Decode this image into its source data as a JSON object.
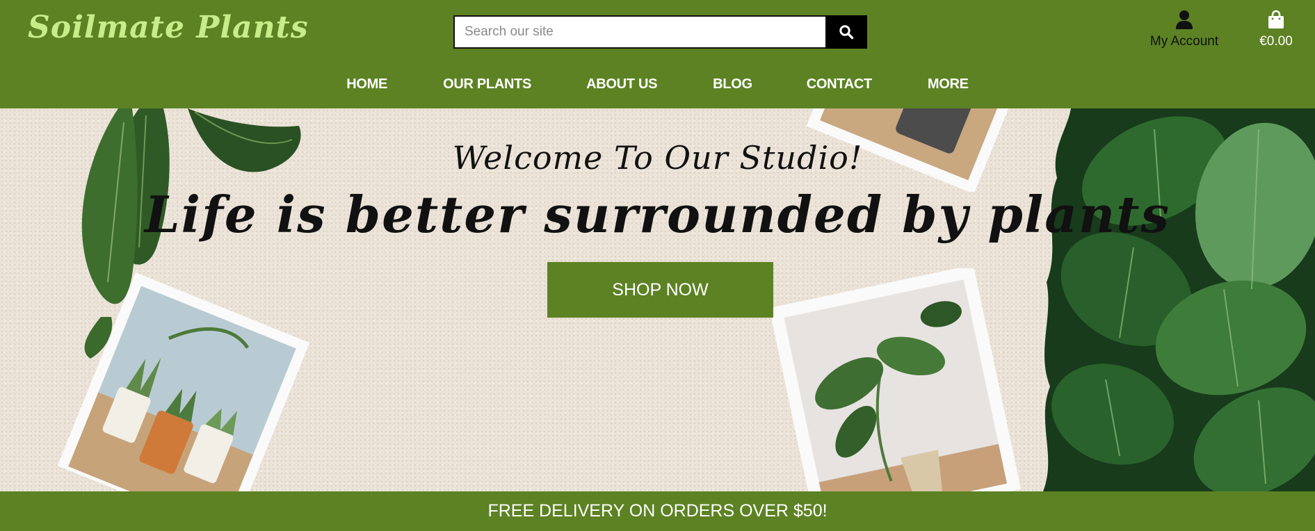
{
  "brand": {
    "name": "Soilmate Plants"
  },
  "search": {
    "placeholder": "Search our site",
    "value": "",
    "button_icon": "search-icon"
  },
  "account": {
    "label": "My Account",
    "icon": "user-icon"
  },
  "cart": {
    "total": "€0.00",
    "icon": "shopping-bag-icon"
  },
  "nav": {
    "items": [
      {
        "label": "HOME"
      },
      {
        "label": "OUR PLANTS"
      },
      {
        "label": "ABOUT US"
      },
      {
        "label": "BLOG"
      },
      {
        "label": "CONTACT"
      },
      {
        "label": "MORE"
      }
    ]
  },
  "hero": {
    "title": "Welcome To Our Studio!",
    "heading": "Life is better surrounded by plants",
    "cta": "SHOP NOW"
  },
  "banner": {
    "text": "FREE DELIVERY ON ORDERS OVER $50!"
  },
  "colors": {
    "brand_green": "#5c8223",
    "logo_green": "#c8ec8a",
    "hero_background": "#ebe3d7",
    "search_button": "#000000"
  }
}
